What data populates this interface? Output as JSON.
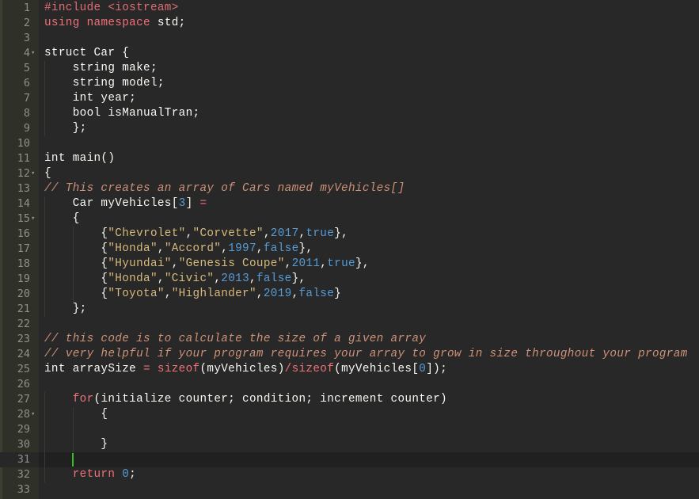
{
  "editor": {
    "active_line": 31,
    "lines": [
      {
        "n": "1",
        "fold": false,
        "indent": 0,
        "tokens": [
          {
            "t": "pp",
            "v": "#include "
          },
          {
            "t": "pp",
            "v": "<iostream>"
          }
        ]
      },
      {
        "n": "2",
        "fold": false,
        "indent": 0,
        "tokens": [
          {
            "t": "kw",
            "v": "using"
          },
          {
            "t": "plain",
            "v": " "
          },
          {
            "t": "kw",
            "v": "namespace"
          },
          {
            "t": "plain",
            "v": " std;"
          }
        ]
      },
      {
        "n": "3",
        "fold": false,
        "indent": 0,
        "tokens": []
      },
      {
        "n": "4",
        "fold": true,
        "indent": 0,
        "tokens": [
          {
            "t": "plain",
            "v": "struct Car {"
          }
        ]
      },
      {
        "n": "5",
        "fold": false,
        "indent": 1,
        "tokens": [
          {
            "t": "plain",
            "v": "    string make;"
          }
        ]
      },
      {
        "n": "6",
        "fold": false,
        "indent": 1,
        "tokens": [
          {
            "t": "plain",
            "v": "    string model;"
          }
        ]
      },
      {
        "n": "7",
        "fold": false,
        "indent": 1,
        "tokens": [
          {
            "t": "plain",
            "v": "    int year;"
          }
        ]
      },
      {
        "n": "8",
        "fold": false,
        "indent": 1,
        "tokens": [
          {
            "t": "plain",
            "v": "    bool isManualTran;"
          }
        ]
      },
      {
        "n": "9",
        "fold": false,
        "indent": 1,
        "tokens": [
          {
            "t": "plain",
            "v": "    };"
          }
        ]
      },
      {
        "n": "10",
        "fold": false,
        "indent": 0,
        "tokens": []
      },
      {
        "n": "11",
        "fold": false,
        "indent": 0,
        "tokens": [
          {
            "t": "plain",
            "v": "int main()"
          }
        ]
      },
      {
        "n": "12",
        "fold": true,
        "indent": 0,
        "tokens": [
          {
            "t": "plain",
            "v": "{"
          }
        ]
      },
      {
        "n": "13",
        "fold": false,
        "indent": 0,
        "tokens": [
          {
            "t": "com",
            "v": "// This creates an array of Cars named myVehicles[]"
          }
        ]
      },
      {
        "n": "14",
        "fold": false,
        "indent": 1,
        "tokens": [
          {
            "t": "plain",
            "v": "    Car myVehicles["
          },
          {
            "t": "num",
            "v": "3"
          },
          {
            "t": "plain",
            "v": "] "
          },
          {
            "t": "op",
            "v": "="
          }
        ]
      },
      {
        "n": "15",
        "fold": true,
        "indent": 1,
        "tokens": [
          {
            "t": "plain",
            "v": "    {"
          }
        ]
      },
      {
        "n": "16",
        "fold": false,
        "indent": 2,
        "tokens": [
          {
            "t": "plain",
            "v": "        {"
          },
          {
            "t": "str",
            "v": "\"Chevrolet\""
          },
          {
            "t": "plain",
            "v": ","
          },
          {
            "t": "str",
            "v": "\"Corvette\""
          },
          {
            "t": "plain",
            "v": ","
          },
          {
            "t": "num",
            "v": "2017"
          },
          {
            "t": "plain",
            "v": ","
          },
          {
            "t": "const",
            "v": "true"
          },
          {
            "t": "plain",
            "v": "},"
          }
        ]
      },
      {
        "n": "17",
        "fold": false,
        "indent": 2,
        "tokens": [
          {
            "t": "plain",
            "v": "        {"
          },
          {
            "t": "str",
            "v": "\"Honda\""
          },
          {
            "t": "plain",
            "v": ","
          },
          {
            "t": "str",
            "v": "\"Accord\""
          },
          {
            "t": "plain",
            "v": ","
          },
          {
            "t": "num",
            "v": "1997"
          },
          {
            "t": "plain",
            "v": ","
          },
          {
            "t": "const",
            "v": "false"
          },
          {
            "t": "plain",
            "v": "},"
          }
        ]
      },
      {
        "n": "18",
        "fold": false,
        "indent": 2,
        "tokens": [
          {
            "t": "plain",
            "v": "        {"
          },
          {
            "t": "str",
            "v": "\"Hyundai\""
          },
          {
            "t": "plain",
            "v": ","
          },
          {
            "t": "str",
            "v": "\"Genesis Coupe\""
          },
          {
            "t": "plain",
            "v": ","
          },
          {
            "t": "num",
            "v": "2011"
          },
          {
            "t": "plain",
            "v": ","
          },
          {
            "t": "const",
            "v": "true"
          },
          {
            "t": "plain",
            "v": "},"
          }
        ]
      },
      {
        "n": "19",
        "fold": false,
        "indent": 2,
        "tokens": [
          {
            "t": "plain",
            "v": "        {"
          },
          {
            "t": "str",
            "v": "\"Honda\""
          },
          {
            "t": "plain",
            "v": ","
          },
          {
            "t": "str",
            "v": "\"Civic\""
          },
          {
            "t": "plain",
            "v": ","
          },
          {
            "t": "num",
            "v": "2013"
          },
          {
            "t": "plain",
            "v": ","
          },
          {
            "t": "const",
            "v": "false"
          },
          {
            "t": "plain",
            "v": "},"
          }
        ]
      },
      {
        "n": "20",
        "fold": false,
        "indent": 2,
        "tokens": [
          {
            "t": "plain",
            "v": "        {"
          },
          {
            "t": "str",
            "v": "\"Toyota\""
          },
          {
            "t": "plain",
            "v": ","
          },
          {
            "t": "str",
            "v": "\"Highlander\""
          },
          {
            "t": "plain",
            "v": ","
          },
          {
            "t": "num",
            "v": "2019"
          },
          {
            "t": "plain",
            "v": ","
          },
          {
            "t": "const",
            "v": "false"
          },
          {
            "t": "plain",
            "v": "}"
          }
        ]
      },
      {
        "n": "21",
        "fold": false,
        "indent": 1,
        "tokens": [
          {
            "t": "plain",
            "v": "    };"
          }
        ]
      },
      {
        "n": "22",
        "fold": false,
        "indent": 0,
        "tokens": []
      },
      {
        "n": "23",
        "fold": false,
        "indent": 0,
        "tokens": [
          {
            "t": "com",
            "v": "// this code is to calculate the size of a given array"
          }
        ]
      },
      {
        "n": "24",
        "fold": false,
        "indent": 0,
        "tokens": [
          {
            "t": "com",
            "v": "// very helpful if your program requires your array to grow in size throughout your program"
          }
        ]
      },
      {
        "n": "25",
        "fold": false,
        "indent": 0,
        "tokens": [
          {
            "t": "plain",
            "v": "int arraySize "
          },
          {
            "t": "op",
            "v": "="
          },
          {
            "t": "plain",
            "v": " "
          },
          {
            "t": "kw",
            "v": "sizeof"
          },
          {
            "t": "plain",
            "v": "(myVehicles)"
          },
          {
            "t": "op",
            "v": "/"
          },
          {
            "t": "kw",
            "v": "sizeof"
          },
          {
            "t": "plain",
            "v": "(myVehicles["
          },
          {
            "t": "num",
            "v": "0"
          },
          {
            "t": "plain",
            "v": "]);"
          }
        ]
      },
      {
        "n": "26",
        "fold": false,
        "indent": 0,
        "tokens": []
      },
      {
        "n": "27",
        "fold": false,
        "indent": 1,
        "tokens": [
          {
            "t": "plain",
            "v": "    "
          },
          {
            "t": "kw",
            "v": "for"
          },
          {
            "t": "plain",
            "v": "(initialize counter; condition; increment counter)"
          }
        ]
      },
      {
        "n": "28",
        "fold": true,
        "indent": 2,
        "tokens": [
          {
            "t": "plain",
            "v": "        {"
          }
        ]
      },
      {
        "n": "29",
        "fold": false,
        "indent": 2,
        "tokens": []
      },
      {
        "n": "30",
        "fold": false,
        "indent": 2,
        "tokens": [
          {
            "t": "plain",
            "v": "        }"
          }
        ]
      },
      {
        "n": "31",
        "fold": false,
        "indent": 1,
        "tokens": []
      },
      {
        "n": "32",
        "fold": false,
        "indent": 1,
        "tokens": [
          {
            "t": "plain",
            "v": "    "
          },
          {
            "t": "kw",
            "v": "return"
          },
          {
            "t": "plain",
            "v": " "
          },
          {
            "t": "num",
            "v": "0"
          },
          {
            "t": "plain",
            "v": ";"
          }
        ]
      },
      {
        "n": "33",
        "fold": false,
        "indent": 0,
        "tokens": []
      }
    ]
  }
}
